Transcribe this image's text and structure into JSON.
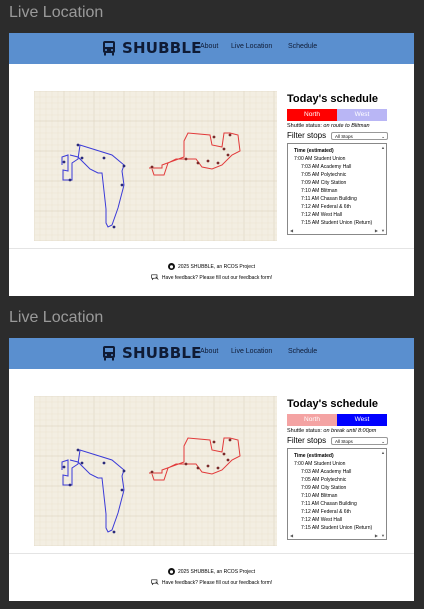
{
  "frame_label": "Live Location",
  "brand": "SHUBBLE",
  "nav": {
    "about": "About",
    "live": "Live Location",
    "schedule": "Schedule"
  },
  "schedule_title": "Today's schedule",
  "routes": {
    "north": "North",
    "west": "West"
  },
  "filter_label": "Filter stops",
  "filter_value": "All Stops",
  "list_header": "Time (estimated)",
  "footer": {
    "copyright": "2025 SHUBBLE, an RCOS Project",
    "feedback": "Have feedback? Please fill out our feedback form!"
  },
  "colors": {
    "header": "#5a8fcf",
    "north_active": "#ff0000",
    "north_inactive": "#f4a3a3",
    "west_active": "#0000ff",
    "west_inactive": "#b9b6f5",
    "north_route": "#e23a3a",
    "west_route": "#3a3ad8"
  },
  "frames": [
    {
      "active": "north",
      "status_prefix": "Shuttle status: ",
      "status_value": "on route to Blitman",
      "rows": [
        "7:00 AM Student Union",
        "7:03 AM Academy Hall",
        "7:05 AM Polytechnic",
        "7:09 AM City Station",
        "7:10 AM Blitman",
        "7:11 AM Chasan Building",
        "7:12 AM Federal & 6th",
        "7:12 AM West Hall",
        "7:15 AM Student Union (Return)"
      ]
    },
    {
      "active": "west",
      "status_prefix": "Shuttle status: ",
      "status_value": "on break until 8:00pm",
      "rows": [
        "7:00 AM Student Union",
        "7:03 AM Academy Hall",
        "7:05 AM Polytechnic",
        "7:09 AM City Station",
        "7:10 AM Blitman",
        "7:11 AM Chasan Building",
        "7:12 AM Federal & 6th",
        "7:12 AM West Hall",
        "7:15 AM Student Union (Return)"
      ]
    }
  ]
}
